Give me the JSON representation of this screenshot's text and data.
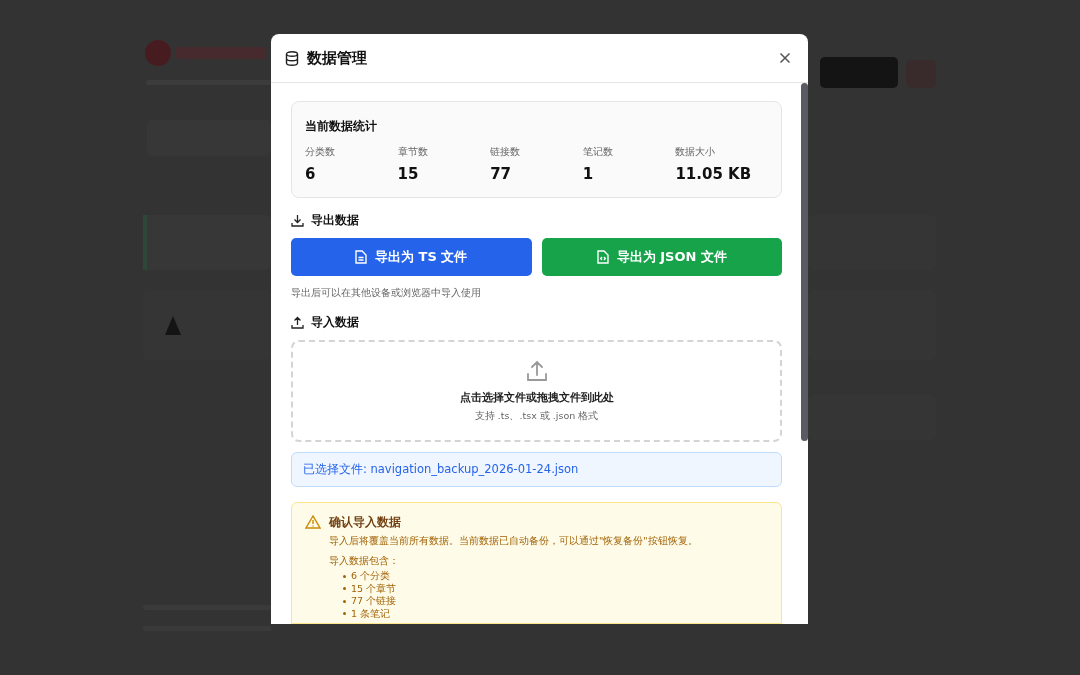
{
  "dialog": {
    "title": "数据管理",
    "stats": {
      "title": "当前数据统计",
      "items": [
        {
          "label": "分类数",
          "value": "6"
        },
        {
          "label": "章节数",
          "value": "15"
        },
        {
          "label": "链接数",
          "value": "77"
        },
        {
          "label": "笔记数",
          "value": "1"
        },
        {
          "label": "数据大小",
          "value": "11.05 KB"
        }
      ]
    },
    "export": {
      "title": "导出数据",
      "buttons": [
        {
          "label": "导出为 TS 文件",
          "kind": "ts"
        },
        {
          "label": "导出为 JSON 文件",
          "kind": "json"
        }
      ],
      "hint": "导出后可以在其他设备或浏览器中导入使用"
    },
    "import": {
      "title": "导入数据",
      "dropzone": {
        "title": "点击选择文件或拖拽文件到此处",
        "hint": "支持 .ts、.tsx 或 .json 格式"
      },
      "selected_file": "已选择文件: navigation_backup_2026-01-24.json"
    },
    "warning": {
      "title": "确认导入数据",
      "message": "导入后将覆盖当前所有数据。当前数据已自动备份，可以通过\"恢复备份\"按钮恢复。",
      "summary_title": "导入数据包含：",
      "items": [
        "6 个分类",
        "15 个章节",
        "77 个链接",
        "1 条笔记"
      ]
    }
  }
}
